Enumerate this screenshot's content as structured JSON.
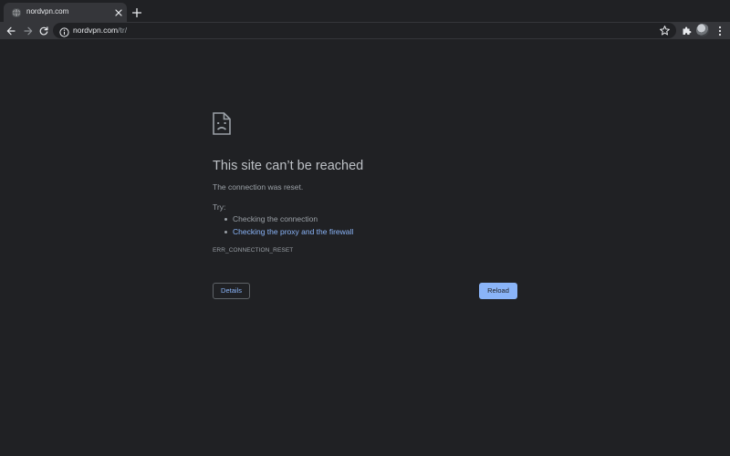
{
  "browser": {
    "tab": {
      "title": "nordvpn.com",
      "favicon": "globe-icon",
      "close_icon": "close-icon"
    },
    "new_tab_icon": "plus-icon",
    "toolbar": {
      "back_icon": "arrow-left-icon",
      "forward_icon": "arrow-right-icon",
      "reload_icon": "reload-icon",
      "url_host": "nordvpn.com",
      "url_path": "/tr/",
      "site_info_icon": "info-icon",
      "bookmark_icon": "star-icon",
      "extensions_icon": "puzzle-icon",
      "menu_icon": "kebab-menu-icon"
    }
  },
  "error_page": {
    "icon": "sad-document-icon",
    "title": "This site can’t be reached",
    "message": "The connection was reset.",
    "try_label": "Try:",
    "suggestions": [
      {
        "text": "Checking the connection",
        "link": false
      },
      {
        "text": "Checking the proxy and the firewall",
        "link": true
      }
    ],
    "error_code": "ERR_CONNECTION_RESET",
    "details_button": "Details",
    "reload_button": "Reload"
  },
  "colors": {
    "page_background": "#202124",
    "toolbar_background": "#35363a",
    "text_primary": "#bdc1c6",
    "text_secondary": "#9aa0a6",
    "link": "#8ab4f8",
    "button_primary": "#8ab4f8"
  }
}
